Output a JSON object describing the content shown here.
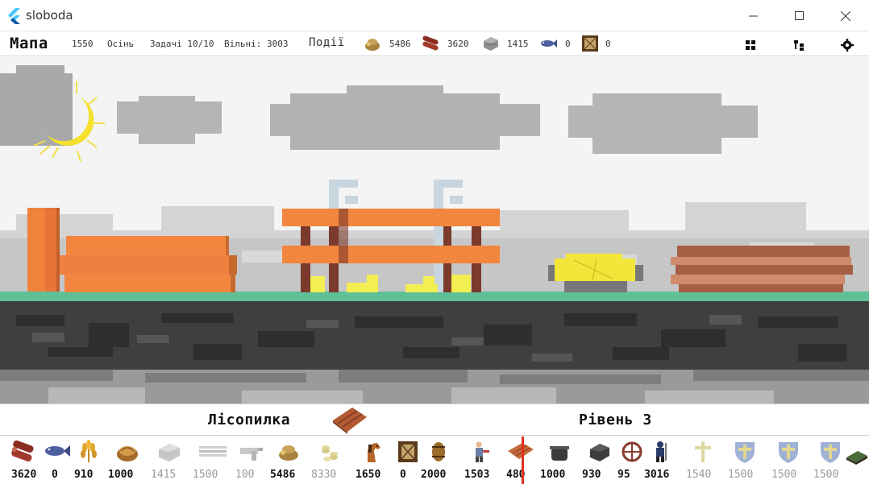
{
  "window": {
    "title": "sloboda"
  },
  "topbar": {
    "title": "Мапа",
    "year": "1550",
    "season": "Осінь",
    "tasks": "Задачі 10/10",
    "free": "Вільні: 3003",
    "events": "Події",
    "resources": [
      {
        "icon": "money-bag-icon",
        "value": "5486"
      },
      {
        "icon": "logs-icon",
        "value": "3620"
      },
      {
        "icon": "stone-icon",
        "value": "1415"
      },
      {
        "icon": "fish-icon",
        "value": "0"
      },
      {
        "icon": "frame-icon",
        "value": "0"
      }
    ]
  },
  "info": {
    "building": "Лісопилка",
    "level": "Рівень 3"
  },
  "items": [
    {
      "icon": "logs-icon",
      "value": "3620",
      "dim": false
    },
    {
      "icon": "fish-icon",
      "value": "0",
      "dim": false
    },
    {
      "icon": "wheat-icon",
      "value": "910",
      "dim": false
    },
    {
      "icon": "bread-basket-icon",
      "value": "1000",
      "dim": false
    },
    {
      "icon": "stone-icon",
      "value": "1415",
      "dim": true
    },
    {
      "icon": "boards-icon",
      "value": "1500",
      "dim": true
    },
    {
      "icon": "ore-icon",
      "value": "100",
      "dim": true
    },
    {
      "icon": "money-bag-icon",
      "value": "5486",
      "dim": false
    },
    {
      "icon": "coins-icon",
      "value": "8330",
      "dim": true
    },
    {
      "icon": "horse-icon",
      "value": "1650",
      "dim": false
    },
    {
      "icon": "frame-icon",
      "value": "0",
      "dim": false
    },
    {
      "icon": "barrel-icon",
      "value": "2000",
      "dim": false
    },
    {
      "icon": "worker-icon",
      "value": "1503",
      "dim": false
    },
    {
      "icon": "planks-icon",
      "value": "480",
      "dim": false
    },
    {
      "icon": "pot-icon",
      "value": "1000",
      "dim": false
    },
    {
      "icon": "coal-icon",
      "value": "930",
      "dim": false
    },
    {
      "icon": "wheel-icon",
      "value": "95",
      "dim": false
    },
    {
      "icon": "soldier-icon",
      "value": "3016",
      "dim": false
    },
    {
      "icon": "cross-icon",
      "value": "1540",
      "dim": true
    },
    {
      "icon": "shield-icon",
      "value": "1500",
      "dim": true
    },
    {
      "icon": "shield-icon",
      "value": "1500",
      "dim": true
    },
    {
      "icon": "shield-icon",
      "value": "1500",
      "dim": true
    },
    {
      "icon": "map-tile-icon",
      "value": "",
      "dim": false
    }
  ]
}
